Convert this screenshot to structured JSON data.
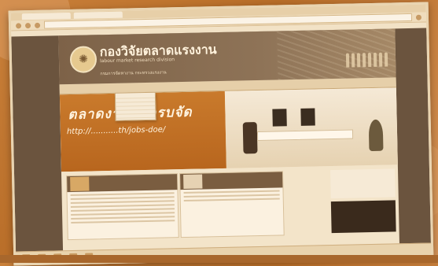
{
  "browser": {
    "tabs": [
      "",
      ""
    ],
    "url": ""
  },
  "site": {
    "title_th": "กองวิจัยตลาดแรงงาน",
    "title_en": "labour market research division",
    "subtitle": "กรมการจัดหางาน  กระทรวงแรงงาน"
  },
  "nav": {
    "items": [
      "",
      "",
      "",
      "",
      "",
      "",
      "",
      ""
    ]
  },
  "dropdown": {
    "items": [
      "",
      "",
      "",
      "",
      "",
      ""
    ]
  },
  "banner": {
    "heading": "ตลาดงาน...ครบจัด",
    "url": "http://...........th/jobs-doe/",
    "footer": ""
  },
  "content": {
    "box1_title": "",
    "box2_title": "",
    "ad_title": ""
  },
  "colors": {
    "tint": "#c9803a",
    "header": "#7d6248",
    "banner_orange": "#c97a2c"
  }
}
